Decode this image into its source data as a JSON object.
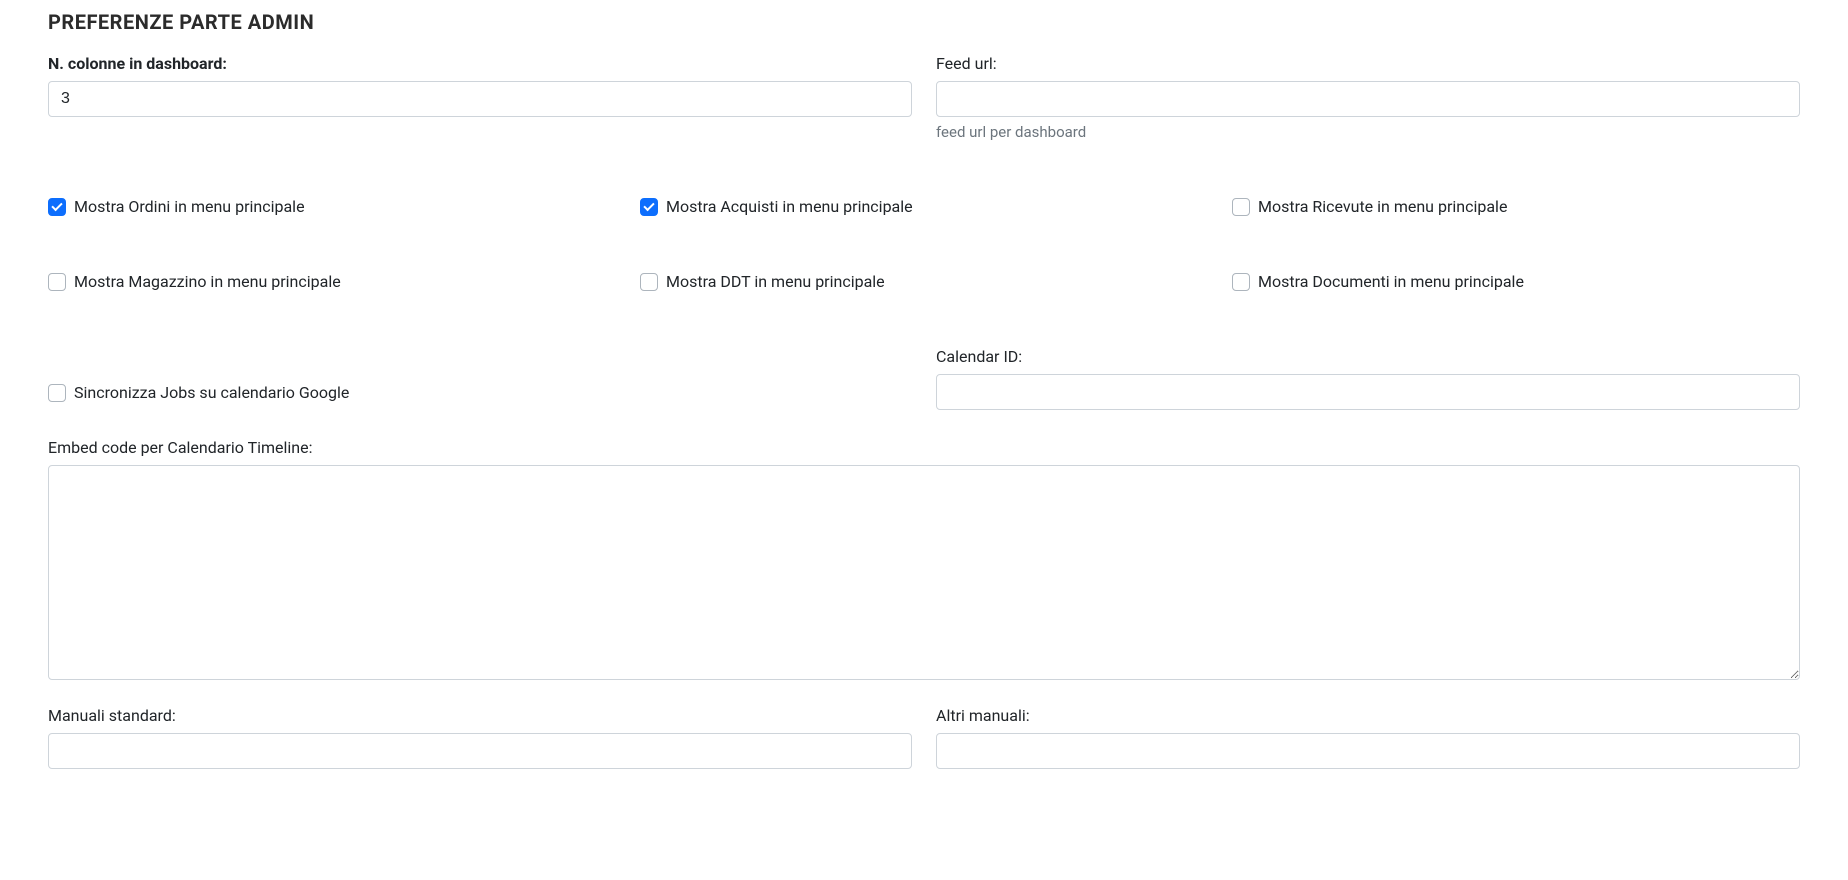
{
  "section": {
    "title": "PREFERENZE PARTE ADMIN"
  },
  "fields": {
    "columns": {
      "label": "N. colonne in dashboard:",
      "value": "3"
    },
    "feedUrl": {
      "label": "Feed url:",
      "value": "",
      "help": "feed url per dashboard"
    },
    "calendarId": {
      "label": "Calendar ID:",
      "value": ""
    },
    "embedCode": {
      "label": "Embed code per Calendario Timeline:",
      "value": ""
    },
    "manualiStandard": {
      "label": "Manuali standard:",
      "value": ""
    },
    "altriManuali": {
      "label": "Altri manuali:",
      "value": ""
    }
  },
  "checkboxes": {
    "mostraOrdini": {
      "label": "Mostra Ordini in menu principale",
      "checked": true
    },
    "mostraAcquisti": {
      "label": "Mostra Acquisti in menu principale",
      "checked": true
    },
    "mostraRicevute": {
      "label": "Mostra Ricevute in menu principale",
      "checked": false
    },
    "mostraMagazzino": {
      "label": "Mostra Magazzino in menu principale",
      "checked": false
    },
    "mostraDdt": {
      "label": "Mostra DDT in menu principale",
      "checked": false
    },
    "mostraDocumenti": {
      "label": "Mostra Documenti in menu principale",
      "checked": false
    },
    "sincronizzaJobs": {
      "label": "Sincronizza Jobs su calendario Google",
      "checked": false
    }
  }
}
